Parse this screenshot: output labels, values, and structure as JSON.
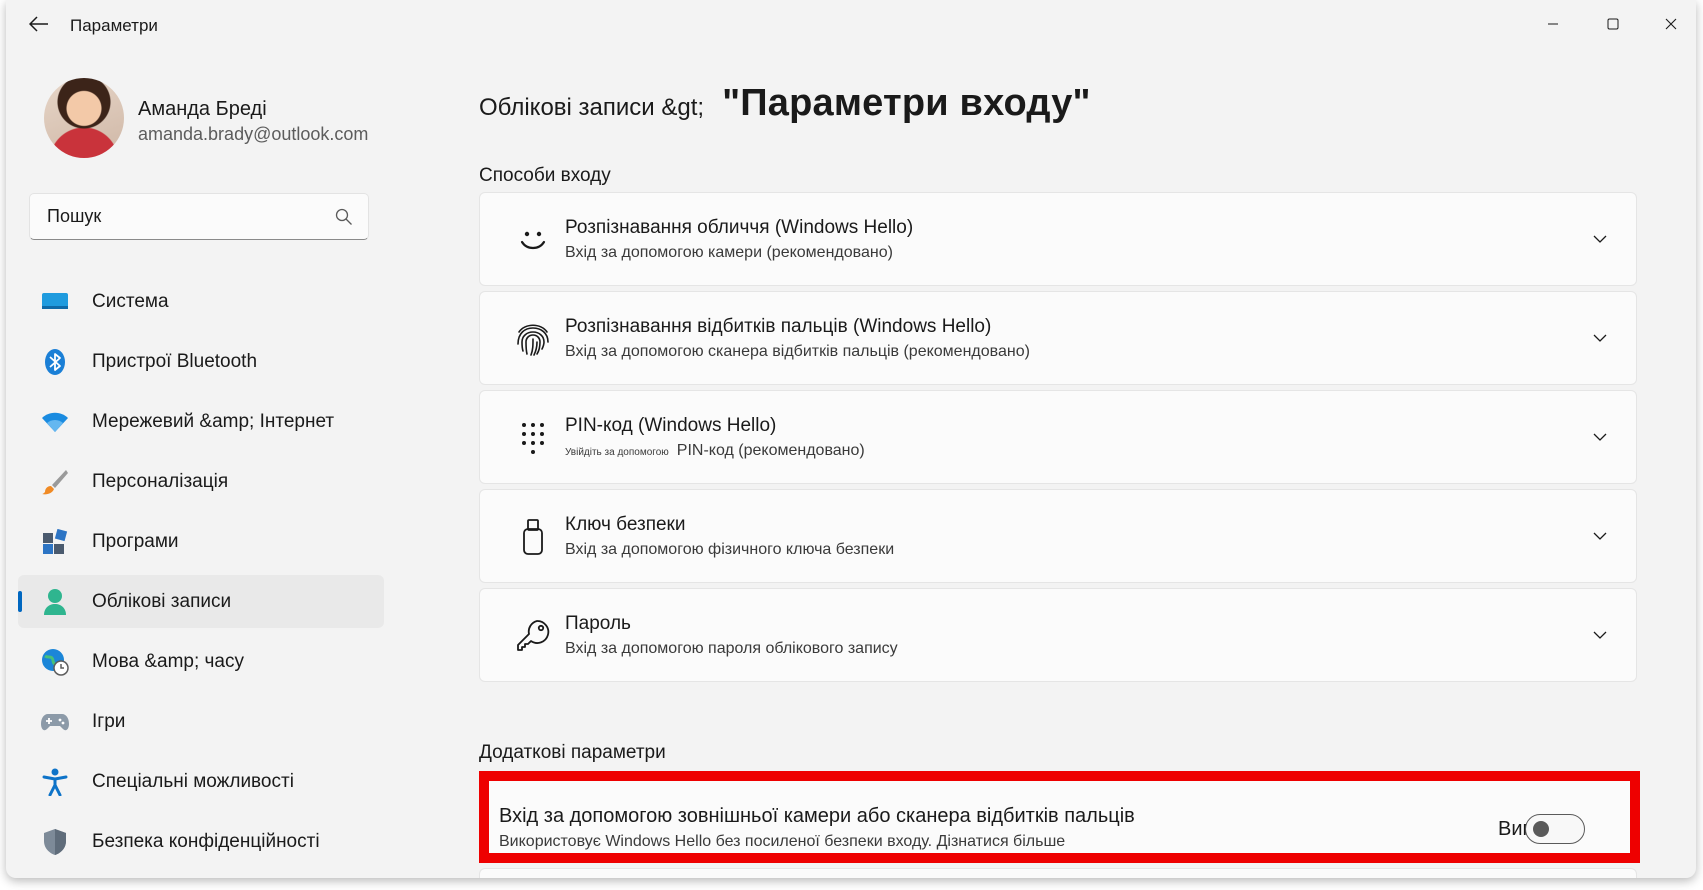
{
  "window": {
    "title": "Параметри"
  },
  "profile": {
    "name": "Аманда Бреді",
    "email": "amanda.brady@outlook.com"
  },
  "search": {
    "placeholder": "Пошук"
  },
  "nav": {
    "items": [
      {
        "label": "Система",
        "icon": "system-icon"
      },
      {
        "label": "Пристрої Bluetooth",
        "icon": "bluetooth-icon"
      },
      {
        "label": "Мережевий &amp; Інтернет",
        "icon": "wifi-icon"
      },
      {
        "label": "Персоналізація",
        "icon": "brush-icon"
      },
      {
        "label": "Програми",
        "icon": "apps-icon"
      },
      {
        "label": "Облікові записи",
        "icon": "accounts-icon",
        "active": true
      },
      {
        "label": "Мова &amp; часу",
        "icon": "time-language-icon"
      },
      {
        "label": "Ігри",
        "icon": "gamepad-icon"
      },
      {
        "label": "Спеціальні можливості",
        "icon": "accessibility-icon"
      },
      {
        "label": "Безпека конфіденційності",
        "icon": "shield-icon"
      }
    ]
  },
  "main": {
    "breadcrumb_parent": "Облікові записи &gt;",
    "breadcrumb_current": "\"Параметри входу\"",
    "signin_section_title": "Способи входу",
    "signin_options": [
      {
        "title": "Розпізнавання обличчя (Windows Hello)",
        "subtitle": "Вхід за допомогою камери (рекомендовано)",
        "icon": "face-icon"
      },
      {
        "title": "Розпізнавання відбитків пальців (Windows Hello)",
        "subtitle": "Вхід за допомогою сканера відбитків пальців (рекомендовано)",
        "icon": "fingerprint-icon"
      },
      {
        "title": "PIN-код (Windows Hello)",
        "subtitle_small": "Увійдіть за допомогою",
        "subtitle": "PIN-код (рекомендовано)",
        "icon": "pin-keypad-icon"
      },
      {
        "title": "Ключ безпеки",
        "subtitle": "Вхід за допомогою фізичного ключа безпеки",
        "icon": "usb-key-icon"
      },
      {
        "title": "Пароль",
        "subtitle": "Вхід за допомогою пароля облікового запису",
        "icon": "key-icon"
      }
    ],
    "additional_section_title": "Додаткові параметри",
    "external_camera": {
      "title": "Вхід за допомогою зовнішньої камери або сканера відбитків пальців",
      "subtitle": "Використовує Windows Hello без посиленої безпеки входу. Дізнатися більше",
      "state_label": "Вимк",
      "enabled": false
    }
  },
  "colors": {
    "accent": "#0067c0",
    "highlight": "#ee0000",
    "window_bg": "#f3f3f3",
    "card_bg": "#fbfbfb"
  }
}
